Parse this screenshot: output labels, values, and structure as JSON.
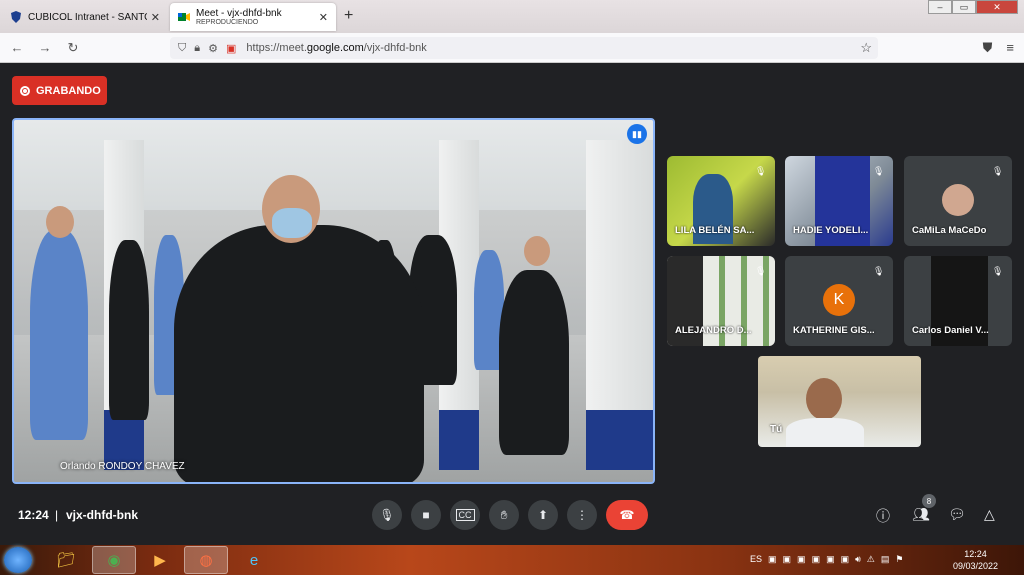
{
  "browser": {
    "tabs": [
      {
        "title": "CUBICOL Intranet - SANTO DOMINGO",
        "sub": ""
      },
      {
        "title": "Meet - vjx-dhfd-bnk",
        "sub": "REPRODUCIENDO"
      }
    ],
    "new_tab": "+",
    "url_prefix": "https://meet.",
    "url_domain": "google.com",
    "url_path": "/vjx-dhfd-bnk"
  },
  "meet": {
    "recording_label": "GRABANDO",
    "main_speaker": "Orlando RONDOY CHAVEZ",
    "participants": [
      {
        "name": "LILA BELÉN SA...",
        "type": "video"
      },
      {
        "name": "HADIE YODELI...",
        "type": "video"
      },
      {
        "name": "CaMiLa MaCeDo",
        "type": "avatar"
      },
      {
        "name": "ALEJANDRO D...",
        "type": "video"
      },
      {
        "name": "KATHERINE GIS...",
        "type": "letter",
        "letter": "K",
        "color": "#e8710a"
      },
      {
        "name": "Carlos Daniel V...",
        "type": "video"
      }
    ],
    "self_label": "Tú",
    "time": "12:24",
    "separator": "|",
    "meeting_code": "vjx-dhfd-bnk",
    "people_count": "8"
  },
  "taskbar": {
    "lang": "ES",
    "time": "12:24",
    "date": "09/03/2022"
  },
  "colors": {
    "recording": "#d93025",
    "end_call": "#ea4335",
    "active_border": "#8ab4f8"
  }
}
